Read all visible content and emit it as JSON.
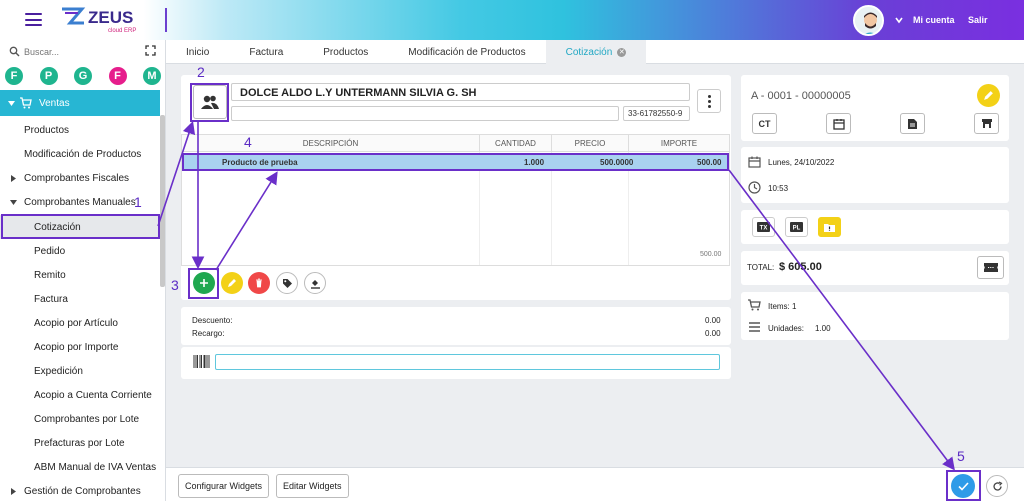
{
  "header": {
    "logo_text": "ZEUS",
    "logo_sub": "cloud ERP",
    "account_label": "Mi cuenta",
    "logout_label": "Salir"
  },
  "sidebar": {
    "search_placeholder": "Buscar...",
    "quick_links": [
      {
        "letter": "F",
        "color": "#1fb58f"
      },
      {
        "letter": "P",
        "color": "#1fb58f"
      },
      {
        "letter": "G",
        "color": "#1fb58f"
      },
      {
        "letter": "F",
        "color": "#e61e8c"
      },
      {
        "letter": "M",
        "color": "#1fb58f"
      }
    ],
    "section_label": "Ventas",
    "items": [
      {
        "label": "Productos"
      },
      {
        "label": "Modificación de Productos"
      },
      {
        "label": "Comprobantes Fiscales"
      },
      {
        "label": "Comprobantes Manuales"
      },
      {
        "label": "Cotización"
      },
      {
        "label": "Pedido"
      },
      {
        "label": "Remito"
      },
      {
        "label": "Factura"
      },
      {
        "label": "Acopio por Artículo"
      },
      {
        "label": "Acopio por Importe"
      },
      {
        "label": "Expedición"
      },
      {
        "label": "Acopio a Cuenta Corriente"
      },
      {
        "label": "Comprobantes por Lote"
      },
      {
        "label": "Prefacturas por Lote"
      },
      {
        "label": "ABM Manual de IVA Ventas"
      },
      {
        "label": "Gestión de Comprobantes"
      }
    ]
  },
  "tabs": [
    {
      "label": "Inicio"
    },
    {
      "label": "Factura"
    },
    {
      "label": "Productos"
    },
    {
      "label": "Modificación de Productos"
    },
    {
      "label": "Cotización"
    }
  ],
  "client": {
    "name": "DOLCE ALDO L.Y UNTERMANN SILVIA G. SH",
    "cuit": "33-61782550-9"
  },
  "grid": {
    "columns": [
      "DESCRIPCIÓN",
      "CANTIDAD",
      "PRECIO",
      "IMPORTE"
    ],
    "rows": [
      {
        "description": "Producto de prueba",
        "quantity": "1.000",
        "price": "500.0000",
        "amount": "500.00"
      }
    ],
    "footer_total": "500.00"
  },
  "adjustments": {
    "discount_label": "Descuento:",
    "discount_value": "0.00",
    "surcharge_label": "Recargo:",
    "surcharge_value": "0.00"
  },
  "document": {
    "number": "A - 0001 - 00000005",
    "ct_label": "CT",
    "date": "Lunes, 24/10/2022",
    "time": "10:53",
    "tag_tx": "TX",
    "tag_pl": "PL",
    "total_label": "TOTAL:",
    "total_value": "$ 605.00",
    "items_label": "Items: 1",
    "units_label": "Unidades:",
    "units_value": "1.00"
  },
  "footer": {
    "configure_label": "Configurar Widgets",
    "edit_label": "Editar Widgets"
  },
  "annotations": [
    "1",
    "2",
    "3",
    "4",
    "5"
  ],
  "colors": {
    "accent": "#27b6d3",
    "annotation": "#6a2fc9",
    "add": "#1fa84f",
    "edit": "#f3d117",
    "delete": "#f04848",
    "confirm": "#2e9be8",
    "selected_row": "#a9d2f0"
  }
}
